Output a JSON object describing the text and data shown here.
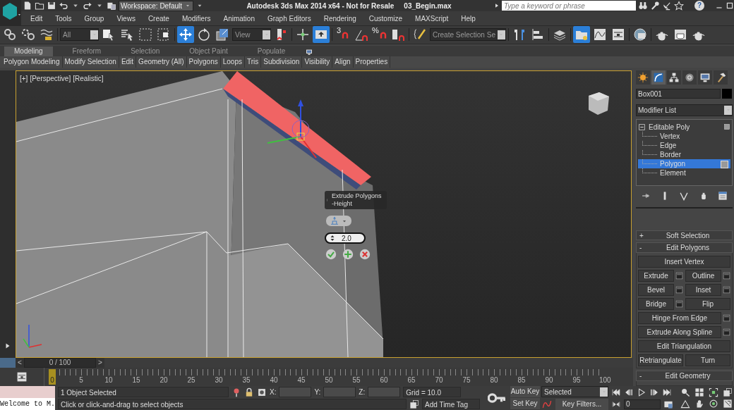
{
  "title_bar": {
    "workspace": "Workspace: Default",
    "title": "Autodesk 3ds Max  2014 x64  - Not for Resale",
    "file": "03_Begin.max",
    "search": {
      "placeholder": "Type a keyword or phrase"
    },
    "help": "?"
  },
  "menu": [
    "Edit",
    "Tools",
    "Group",
    "Views",
    "Create",
    "Modifiers",
    "Animation",
    "Graph Editors",
    "Rendering",
    "Customize",
    "MAXScript",
    "Help"
  ],
  "toolbar": [
    {
      "kind": "icon",
      "selected": false
    },
    {
      "kind": "icon",
      "selected": false
    },
    {
      "kind": "icon",
      "selected": false
    },
    {
      "kind": "sep"
    },
    {
      "kind": "dropdown",
      "value": "All"
    },
    {
      "kind": "icon",
      "selected": false
    },
    {
      "kind": "icon",
      "selected": false
    },
    {
      "kind": "icon",
      "selected": false
    },
    {
      "kind": "icon",
      "selected": false
    },
    {
      "kind": "sep"
    },
    {
      "kind": "icon",
      "selected": true
    },
    {
      "kind": "icon",
      "selected": false
    },
    {
      "kind": "icon",
      "selected": false
    },
    {
      "kind": "dropdown",
      "value": "View"
    },
    {
      "kind": "icon",
      "selected": false
    },
    {
      "kind": "sep"
    },
    {
      "kind": "icon",
      "selected": false
    },
    {
      "kind": "icon",
      "selected": true
    },
    {
      "kind": "sep"
    },
    {
      "kind": "snap",
      "label": "3",
      "selected": false
    },
    {
      "kind": "icon",
      "selected": false
    },
    {
      "kind": "snap",
      "label": "%",
      "selected": false
    },
    {
      "kind": "icon",
      "selected": false
    },
    {
      "kind": "sep"
    },
    {
      "kind": "icon",
      "selected": false
    },
    {
      "kind": "dropdown",
      "value": "Create Selection Se"
    },
    {
      "kind": "sep"
    },
    {
      "kind": "icon",
      "selected": false
    },
    {
      "kind": "icon",
      "selected": false
    },
    {
      "kind": "sep"
    },
    {
      "kind": "icon",
      "selected": false
    },
    {
      "kind": "sep"
    },
    {
      "kind": "icon",
      "selected": true
    },
    {
      "kind": "icon",
      "selected": false
    },
    {
      "kind": "icon",
      "selected": false
    },
    {
      "kind": "sep"
    },
    {
      "kind": "icon",
      "selected": false
    },
    {
      "kind": "sep"
    },
    {
      "kind": "icon",
      "selected": false
    },
    {
      "kind": "icon",
      "selected": false
    },
    {
      "kind": "icon",
      "selected": false
    }
  ],
  "ribbon": {
    "tabs": [
      {
        "label": "Modeling",
        "selected": true
      },
      {
        "label": "Freeform",
        "selected": false
      },
      {
        "label": "Selection",
        "selected": false
      },
      {
        "label": "Object Paint",
        "selected": false
      },
      {
        "label": "Populate",
        "selected": false
      }
    ],
    "panels": [
      "Polygon Modeling",
      "Modify Selection",
      "Edit",
      "Geometry (All)",
      "Polygons",
      "Loops",
      "Tris",
      "Subdivision",
      "Visibility",
      "Align",
      "Properties"
    ]
  },
  "viewport": {
    "labels": [
      "[+]",
      "[Perspective]",
      "[Realistic]"
    ],
    "active": true,
    "caddy": {
      "title": "Extrude Polygons",
      "subtitle": "-Height",
      "value": "2.0"
    }
  },
  "command_panel": {
    "tabs": [
      {
        "selected": false
      },
      {
        "selected": true
      },
      {
        "selected": false
      },
      {
        "selected": false
      },
      {
        "selected": false
      },
      {
        "selected": false
      }
    ],
    "object_name": "Box001",
    "modifier_list": "Modifier List",
    "stack": [
      {
        "label": "Editable Poly",
        "expanded": true,
        "children": [
          {
            "label": "Vertex",
            "selected": false
          },
          {
            "label": "Edge",
            "selected": false
          },
          {
            "label": "Border",
            "selected": false
          },
          {
            "label": "Polygon",
            "selected": true
          },
          {
            "label": "Element",
            "selected": false
          }
        ]
      }
    ],
    "rollouts": [
      {
        "sign": "+",
        "title": "Soft Selection",
        "expanded": false
      },
      {
        "sign": "-",
        "title": "Edit Polygons",
        "expanded": true,
        "rows": [
          [
            {
              "label": "Insert Vertex",
              "settings": false
            }
          ],
          [
            {
              "label": "Extrude",
              "settings": true
            },
            {
              "label": "Outline",
              "settings": true
            }
          ],
          [
            {
              "label": "Bevel",
              "settings": true
            },
            {
              "label": "Inset",
              "settings": true
            }
          ],
          [
            {
              "label": "Bridge",
              "settings": true
            },
            {
              "label": "Flip",
              "settings": false
            }
          ],
          [
            {
              "label": "Hinge From Edge",
              "settings": true
            }
          ],
          [
            {
              "label": "Extrude Along Spline",
              "settings": true
            }
          ],
          [
            {
              "label": "Edit Triangulation",
              "settings": false
            }
          ],
          [
            {
              "label": "Retriangulate",
              "settings": false
            },
            {
              "label": "Turn",
              "settings": false
            }
          ]
        ]
      },
      {
        "sign": "-",
        "title": "Edit Geometry",
        "expanded": true
      }
    ]
  },
  "timeline": {
    "prev": "<",
    "position": "0 / 100",
    "next": ">",
    "ticks": [
      "0",
      "5",
      "10",
      "15",
      "20",
      "25",
      "30",
      "35",
      "40",
      "45",
      "50",
      "55",
      "60",
      "65",
      "70",
      "75",
      "80",
      "85",
      "90",
      "95",
      "100"
    ]
  },
  "status": {
    "listener": "Welcome to M.",
    "selection": "1 Object Selected",
    "x_label": "X:",
    "y_label": "Y:",
    "z_label": "Z:",
    "grid": "Grid = 10.0",
    "prompt": "Click or click-and-drag to select objects",
    "time_tag": "Add Time Tag",
    "auto_key": {
      "label": "Auto Key",
      "on": false
    },
    "set_key": "Set Key",
    "key_mode": "Selected",
    "key_filters": "Key Filters...",
    "frame": "0"
  }
}
